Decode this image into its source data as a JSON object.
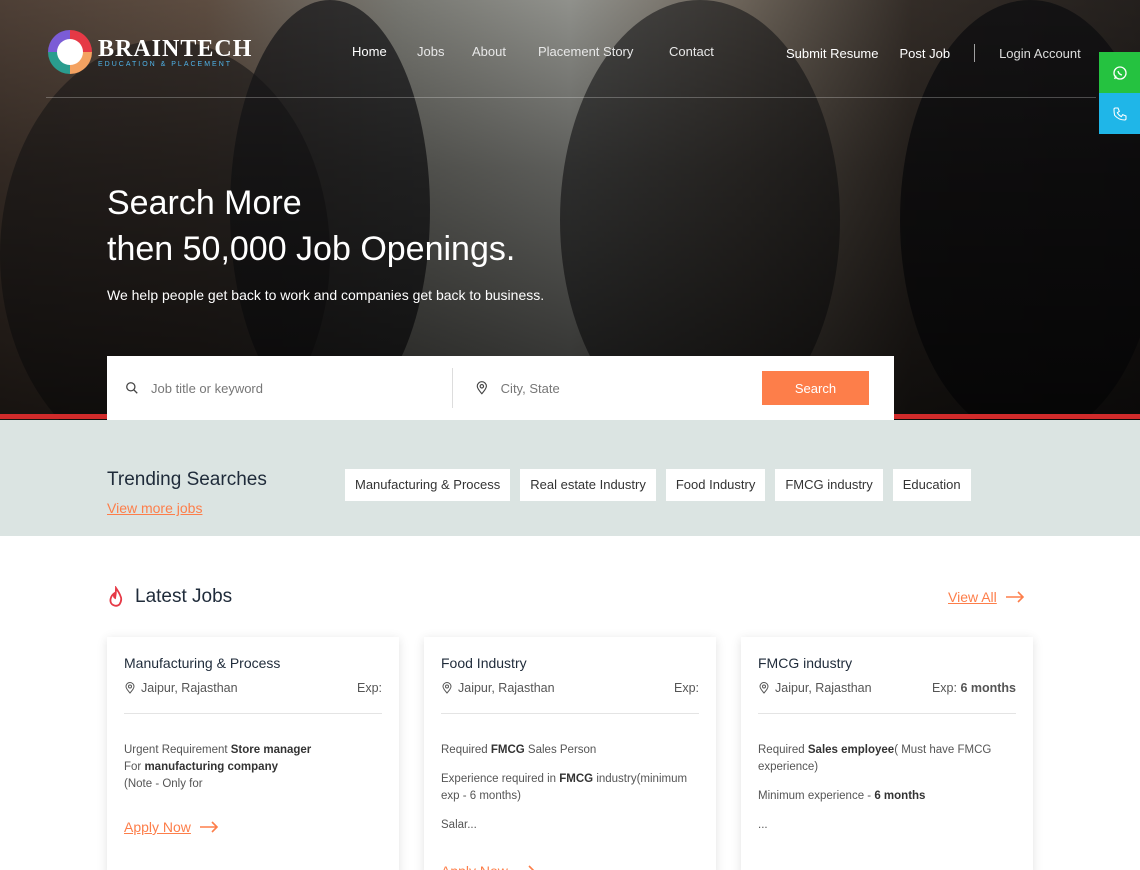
{
  "brand": {
    "name": "BRAINTECH",
    "tagline": "EDUCATION & PLACEMENT"
  },
  "nav": {
    "items": [
      "Home",
      "Jobs",
      "About",
      "Placement Story",
      "Contact"
    ],
    "submit_resume": "Submit Resume",
    "post_job": "Post Job",
    "login": "Login Account"
  },
  "hero": {
    "title_line1": "Search More",
    "title_line2": "then 50,000 Job Openings.",
    "subtitle": "We help people get back to work and companies get back to business."
  },
  "search": {
    "keyword_placeholder": "Job title or keyword",
    "location_placeholder": "City, State",
    "button": "Search"
  },
  "trending": {
    "title": "Trending Searches",
    "link": "View more jobs",
    "tags": [
      "Manufacturing & Process",
      "Real estate Industry",
      "Food Industry",
      "FMCG industry",
      "Education"
    ]
  },
  "latest": {
    "title": "Latest Jobs",
    "view_all": "View All",
    "apply": "Apply Now",
    "cards": [
      {
        "title": "Manufacturing & Process",
        "location": "Jaipur, Rajasthan",
        "exp_label": "Exp:",
        "exp_value": "",
        "desc": [
          [
            "Urgent Requirement ",
            "Store manager",
            ""
          ],
          [
            "For ",
            "manufacturing company",
            ""
          ],
          [
            "(Note -  Only for",
            "",
            ""
          ]
        ]
      },
      {
        "title": "Food Industry",
        "location": "Jaipur, Rajasthan",
        "exp_label": "Exp:",
        "exp_value": "",
        "desc": [
          [
            "Required ",
            "FMCG",
            " Sales Person"
          ],
          [
            "Experience required in ",
            "FMCG",
            " industry(minimum exp - 6 months)"
          ],
          [
            "Salar...",
            "",
            ""
          ]
        ]
      },
      {
        "title": "FMCG industry",
        "location": "Jaipur, Rajasthan",
        "exp_label": "Exp:",
        "exp_value": "6 months",
        "desc": [
          [
            "Required ",
            "Sales employee",
            "( Must have FMCG experience)"
          ],
          [
            "Minimum experience - ",
            "6 months",
            ""
          ],
          [
            "...",
            "",
            ""
          ]
        ]
      }
    ]
  },
  "colors": {
    "accent": "#fd7e4a",
    "whatsapp": "#25c240",
    "phone": "#1fb6e8",
    "trending_bg": "#dbe4e2",
    "hero_line": "#d12b2b"
  },
  "icons": [
    "whatsapp-icon",
    "phone-icon",
    "search-icon",
    "location-pin-icon",
    "flame-icon",
    "arrow-right-icon"
  ]
}
